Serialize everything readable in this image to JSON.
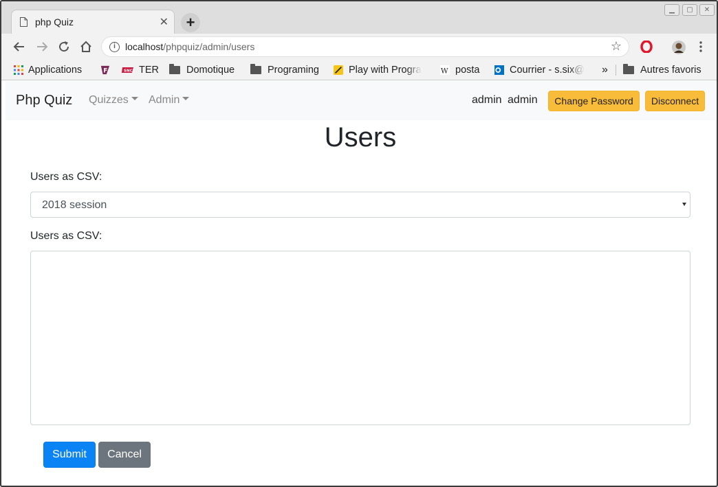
{
  "browser": {
    "tab_title": "php Quiz",
    "new_tab_label": "+",
    "url_host": "localhost",
    "url_path": "/phpquiz/admin/users",
    "bookmarks": [
      {
        "label": "Applications"
      },
      {
        "label": "TER"
      },
      {
        "label": "Domotique"
      },
      {
        "label": "Programing"
      },
      {
        "label": "Play with Progra"
      },
      {
        "label": "posta"
      },
      {
        "label": "Courrier - s.six@"
      }
    ],
    "bookmarks_overflow": "»",
    "other_bookmarks": "Autres favoris"
  },
  "navbar": {
    "brand": "Php Quiz",
    "menu_quizzes": "Quizzes",
    "menu_admin": "Admin",
    "user_display": "admin admin",
    "change_password": "Change Password",
    "disconnect": "Disconnect"
  },
  "page": {
    "title": "Users",
    "select_label": "Users as CSV:",
    "select_value": "2018 session",
    "textarea_label": "Users as CSV:",
    "textarea_value": "",
    "submit": "Submit",
    "cancel": "Cancel"
  },
  "colors": {
    "primary": "#0a84f5",
    "secondary": "#6c757d",
    "warning": "#f8bb3a",
    "navbar_bg": "#f8f9fa"
  },
  "icons": [
    "page-icon",
    "close-icon",
    "back-icon",
    "forward-icon",
    "reload-icon",
    "home-icon",
    "info-icon",
    "star-icon",
    "opera-icon",
    "avatar-icon",
    "menu-icon",
    "apps-icon",
    "folder-icon",
    "wikipedia-icon",
    "outlook-icon"
  ]
}
